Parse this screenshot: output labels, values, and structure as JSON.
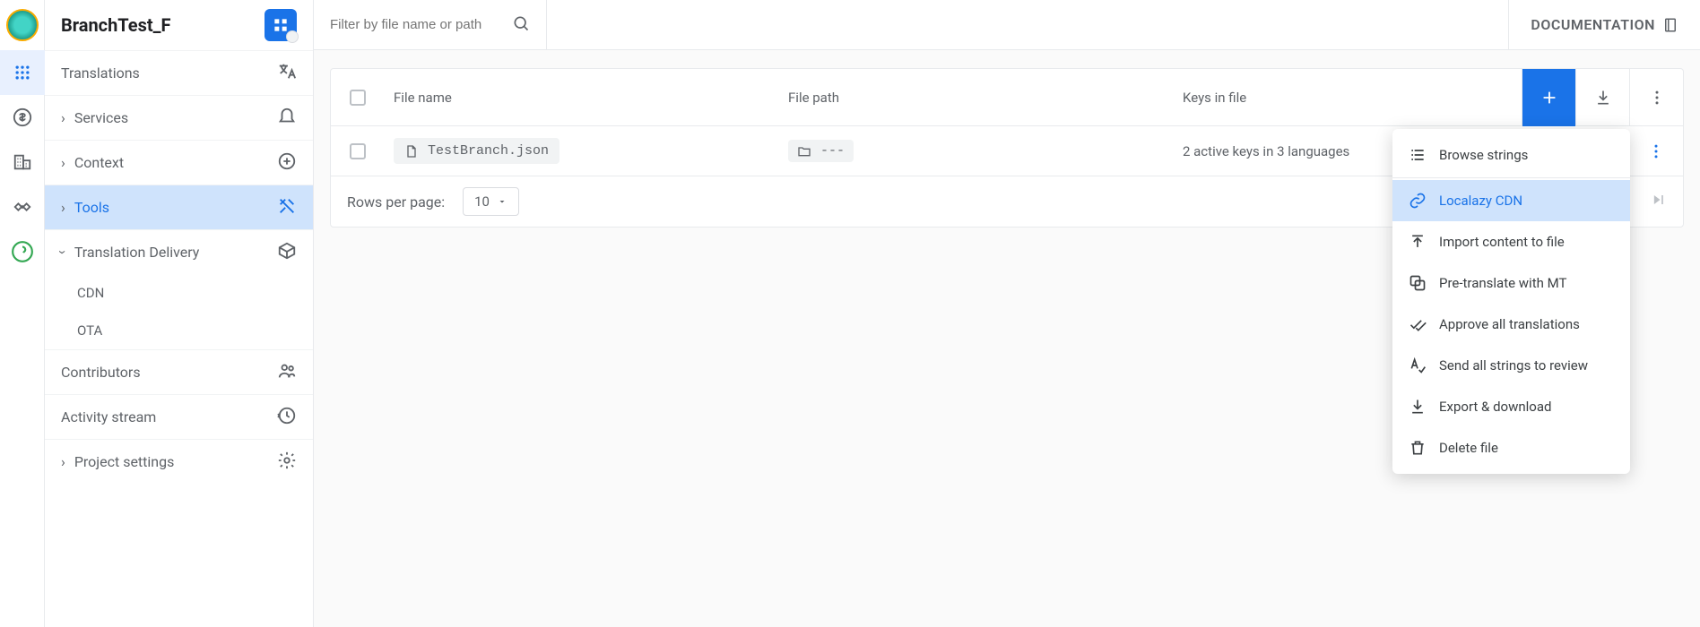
{
  "project_name": "BranchTest_F",
  "top": {
    "filter_placeholder": "Filter by file name or path",
    "doc_label": "DOCUMENTATION"
  },
  "sidebar": {
    "translations": "Translations",
    "services": "Services",
    "context": "Context",
    "tools": "Tools",
    "translation_delivery": "Translation Delivery",
    "cdn": "CDN",
    "ota": "OTA",
    "contributors": "Contributors",
    "activity": "Activity stream",
    "project_settings": "Project settings"
  },
  "table": {
    "col_filename": "File name",
    "col_filepath": "File path",
    "col_keys": "Keys in file",
    "rows": [
      {
        "file": "TestBranch.json",
        "path": "---",
        "keys": "2 active keys in 3 languages"
      }
    ],
    "rows_per_page_label": "Rows per page:",
    "rows_per_page_value": "10"
  },
  "menu": {
    "browse": "Browse strings",
    "cdn": "Localazy CDN",
    "import": "Import content to file",
    "pretranslate": "Pre-translate with MT",
    "approve": "Approve all translations",
    "review": "Send all strings to review",
    "export": "Export & download",
    "delete": "Delete file"
  }
}
